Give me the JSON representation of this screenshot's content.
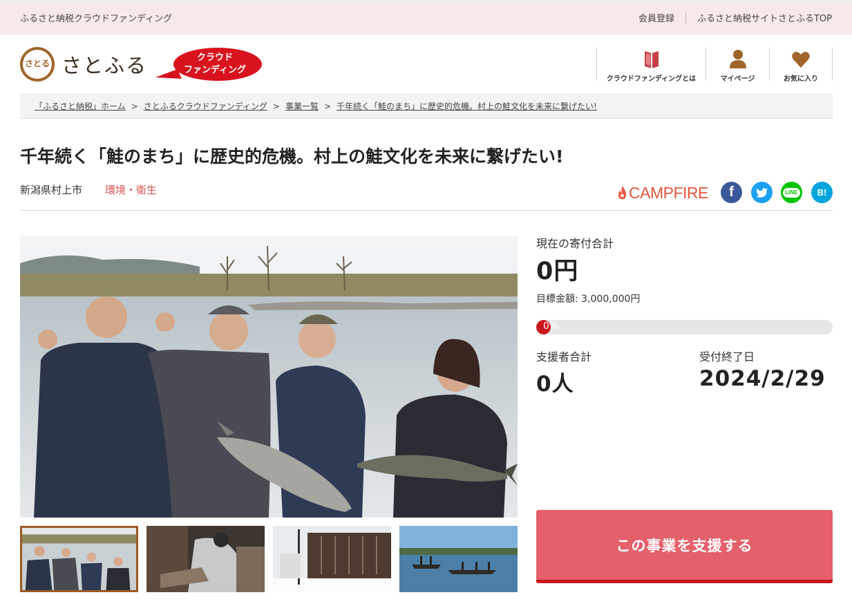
{
  "topbar": {
    "site_name": "ふるさと納税クラウドファンディング",
    "links": [
      "会員登録",
      "ふるさと納税サイトさとふるTOP"
    ]
  },
  "header": {
    "logo_glyph": "さとる",
    "logo_text": "さとふる",
    "badge_line1": "クラウド",
    "badge_line2": "ファンディング",
    "nav": [
      {
        "label": "クラウドファンディングとは",
        "icon": "book-icon"
      },
      {
        "label": "マイページ",
        "icon": "user-icon"
      },
      {
        "label": "お気に入り",
        "icon": "heart-icon"
      }
    ]
  },
  "breadcrumb": [
    "「ふるさと納税」ホーム",
    "さとふるクラウドファンディング",
    "事業一覧",
    "千年続く「鮭のまち」に歴史的危機。村上の鮭文化を未来に繋げたい!"
  ],
  "project": {
    "title": "千年続く「鮭のまち」に歴史的危機。村上の鮭文化を未来に繋げたい!",
    "location": "新潟県村上市",
    "category": "環境・衛生",
    "partner": "CAMPFIRE"
  },
  "share": {
    "facebook": "f",
    "twitter": "t",
    "line": "LINE",
    "hatena": "B!"
  },
  "stats": {
    "current_label": "現在の寄付合計",
    "current_value": "0円",
    "target_text": "目標金額: 3,000,000円",
    "progress_percent": 0,
    "progress_text": "0%",
    "supporters_label": "支援者合計",
    "supporters_value": "0人",
    "deadline_label": "受付終了日",
    "deadline_value": "2024/2/29"
  },
  "support_button": "この事業を支援する",
  "colors": {
    "accent_red": "#c9161d",
    "button_red": "#e4606a",
    "brand_brown": "#a0652a",
    "topbar_pink": "#f7e9ea"
  }
}
